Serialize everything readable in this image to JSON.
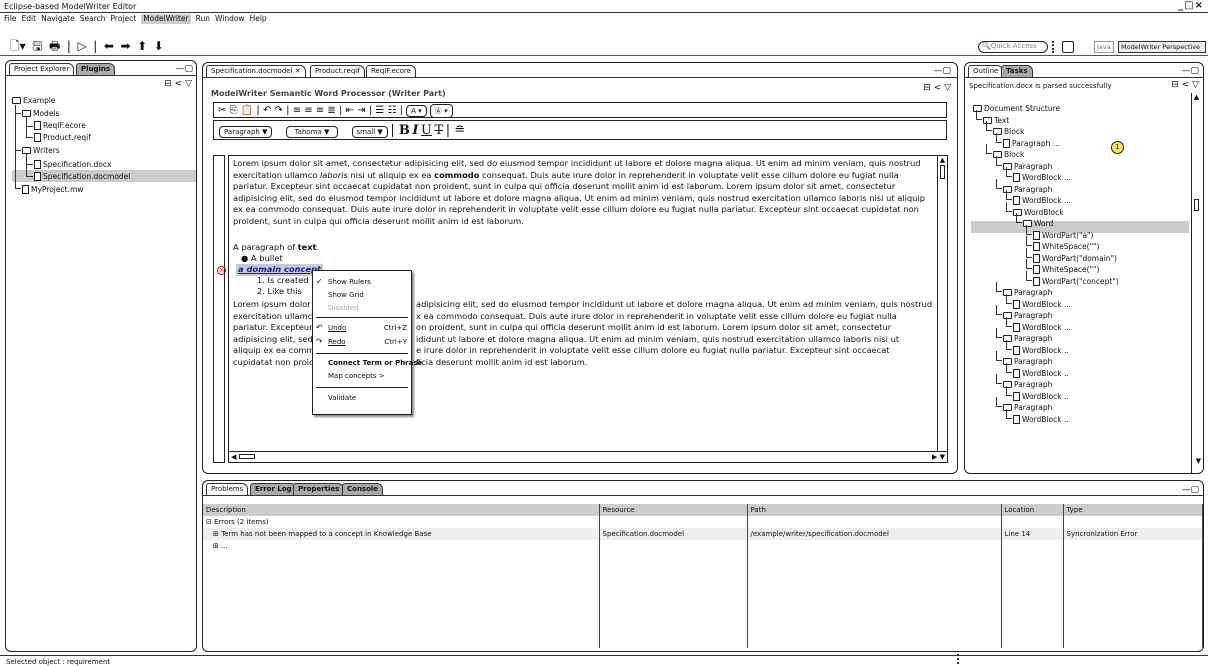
{
  "window": {
    "title": "Eclipse-based ModelWriter Editor",
    "controls": "_□×"
  },
  "menu": [
    "File",
    "Edit",
    "Navigate",
    "Search",
    "Project",
    "ModelWriter",
    "Run",
    "Window",
    "Help"
  ],
  "toolbar": {
    "quick_access": "Quick Access",
    "java": "Java",
    "perspective": "ModelWriter Perspective"
  },
  "left": {
    "tabs": [
      "Project Explorer",
      "Plugins"
    ],
    "tree": [
      "Example",
      "Models",
      "ReqIF.ecore",
      "Product.reqif",
      "Writers",
      "Specification.docx",
      "Specification.docmodel",
      "MyProject.mw"
    ]
  },
  "editor": {
    "tabs": [
      "Specification.docmodel",
      "Product.reqif",
      "ReqIF.ecore"
    ],
    "heading": "ModelWriter Semantic Word Processor (Writer Part)",
    "format": {
      "style": "Paragraph",
      "font": "Tahoma",
      "size": "small"
    },
    "p1a": "Lorem ipsum dolor sit amet, consectetur adipisicing elit, sed do eiusmod tempor incididunt ut labore et dolore magna aliqua. Ut enim ad minim veniam, quis nostrud exercitation ullamco ",
    "p1b": "laboris",
    "p1c": " nisi ut aliquip ex ea ",
    "p1d": "commodo",
    "p1e": " consequat. Duis aute irure dolor in reprehenderit in voluptate velit esse cillum dolore eu fugiat nulla pariatur. Excepteur sint occaecat cupidatat non proident, sunt in culpa qui officia deserunt mollit anim id est laborum. Lorem ipsum dolor sit amet, consectetur adipisicing elit, sed do eiusmod tempor incididunt ut labore et dolore magna aliqua. Ut enim ad minim veniam, quis nostrud exercitation ullamco laboris nisi ut aliquip ex ea commodo consequat. Duis aute irure dolor in reprehenderit in voluptate velit esse cillum dolore eu fugiat nulla pariatur. Excepteur sint occaecat cupidatat non proident, sunt in culpa qui officia deserunt mollit anim id est laborum.",
    "p2a": "A paragraph of ",
    "p2b": "text",
    "p2c": ".",
    "bullet": "A bullet",
    "concept": "a domain concept",
    "num1": "1.  Is created",
    "num2": "2.  Like this",
    "p3l": [
      "Lorem ipsum dolor",
      "exercitation ullamco",
      "pariatur. Excepteur",
      "adipisicing elit, sed",
      "aliquip ex ea commo",
      "cupidatat non proid"
    ],
    "p3r": [
      "adipisicing elit, sed do eiusmod tempor incididunt ut labore et dolore magna aliqua. Ut enim ad minim veniam, quis nostrud",
      "x ea commodo consequat. Duis aute irure dolor in reprehenderit in voluptate velit esse cillum dolore eu fugiat nulla",
      "on proident, sunt in culpa qui officia deserunt mollit anim id est laborum. Lorem ipsum dolor sit amet, consectetur",
      "ididunt ut labore et dolore magna aliqua. Ut enim ad minim veniam, quis nostrud exercitation ullamco laboris nisi ut",
      "e irure dolor in reprehenderit in voluptate velit esse cillum dolore eu fugiat nulla pariatur. Excepteur sint occaecat",
      "ficia deserunt mollit anim id est laborum."
    ]
  },
  "context_menu": {
    "show_rulers": "Show Rulers",
    "show_grid": "Show Grid",
    "disabled": "Disabled",
    "undo": "Undo",
    "undo_sc": "Ctrl+Z",
    "redo": "Redo",
    "redo_sc": "Ctrl+Y",
    "connect": "Connect Term or Phrase",
    "map": "Map concepts >",
    "validate": "Validate"
  },
  "outline": {
    "tabs": [
      "Outline",
      "Tasks"
    ],
    "status": "Specification.docx is parsed successfully",
    "badge": "1",
    "nodes": [
      "Document Structure",
      "Text",
      "Block",
      "Paragraph ...",
      "Block",
      "Paragraph",
      "WordBlock ...",
      "Paragraph",
      "WordBlock ...",
      "WordBlock",
      "Word",
      "WordPart(\"a\")",
      "WhiteSpace(\"\")",
      "WordPart(\"domain\")",
      "WhiteSpace(\"\")",
      "WordPart(\"concept\")",
      "Paragraph",
      "WordBlock ...",
      "Paragraph",
      "WordBlock ...",
      "Paragraph",
      "WordBlock ..",
      "Paragraph",
      "WordBlock ..",
      "Paragraph",
      "WordBlock ..",
      "Paragraph",
      "WordBlock .."
    ]
  },
  "bottom": {
    "tabs": [
      "Problems",
      "Error Log",
      "Properties",
      "Console"
    ],
    "headers": [
      "Description",
      "Resource",
      "Path",
      "Location",
      "Type"
    ],
    "group": "Errors (2 items)",
    "row": [
      "Term has not been mapped to a concept in Knowledge Base",
      "Specification.docmodel",
      "/example/writer/specification.docmodel",
      "Line 14",
      "Syncronization  Error"
    ],
    "row2": "..."
  },
  "status": "Selected object : requirement"
}
